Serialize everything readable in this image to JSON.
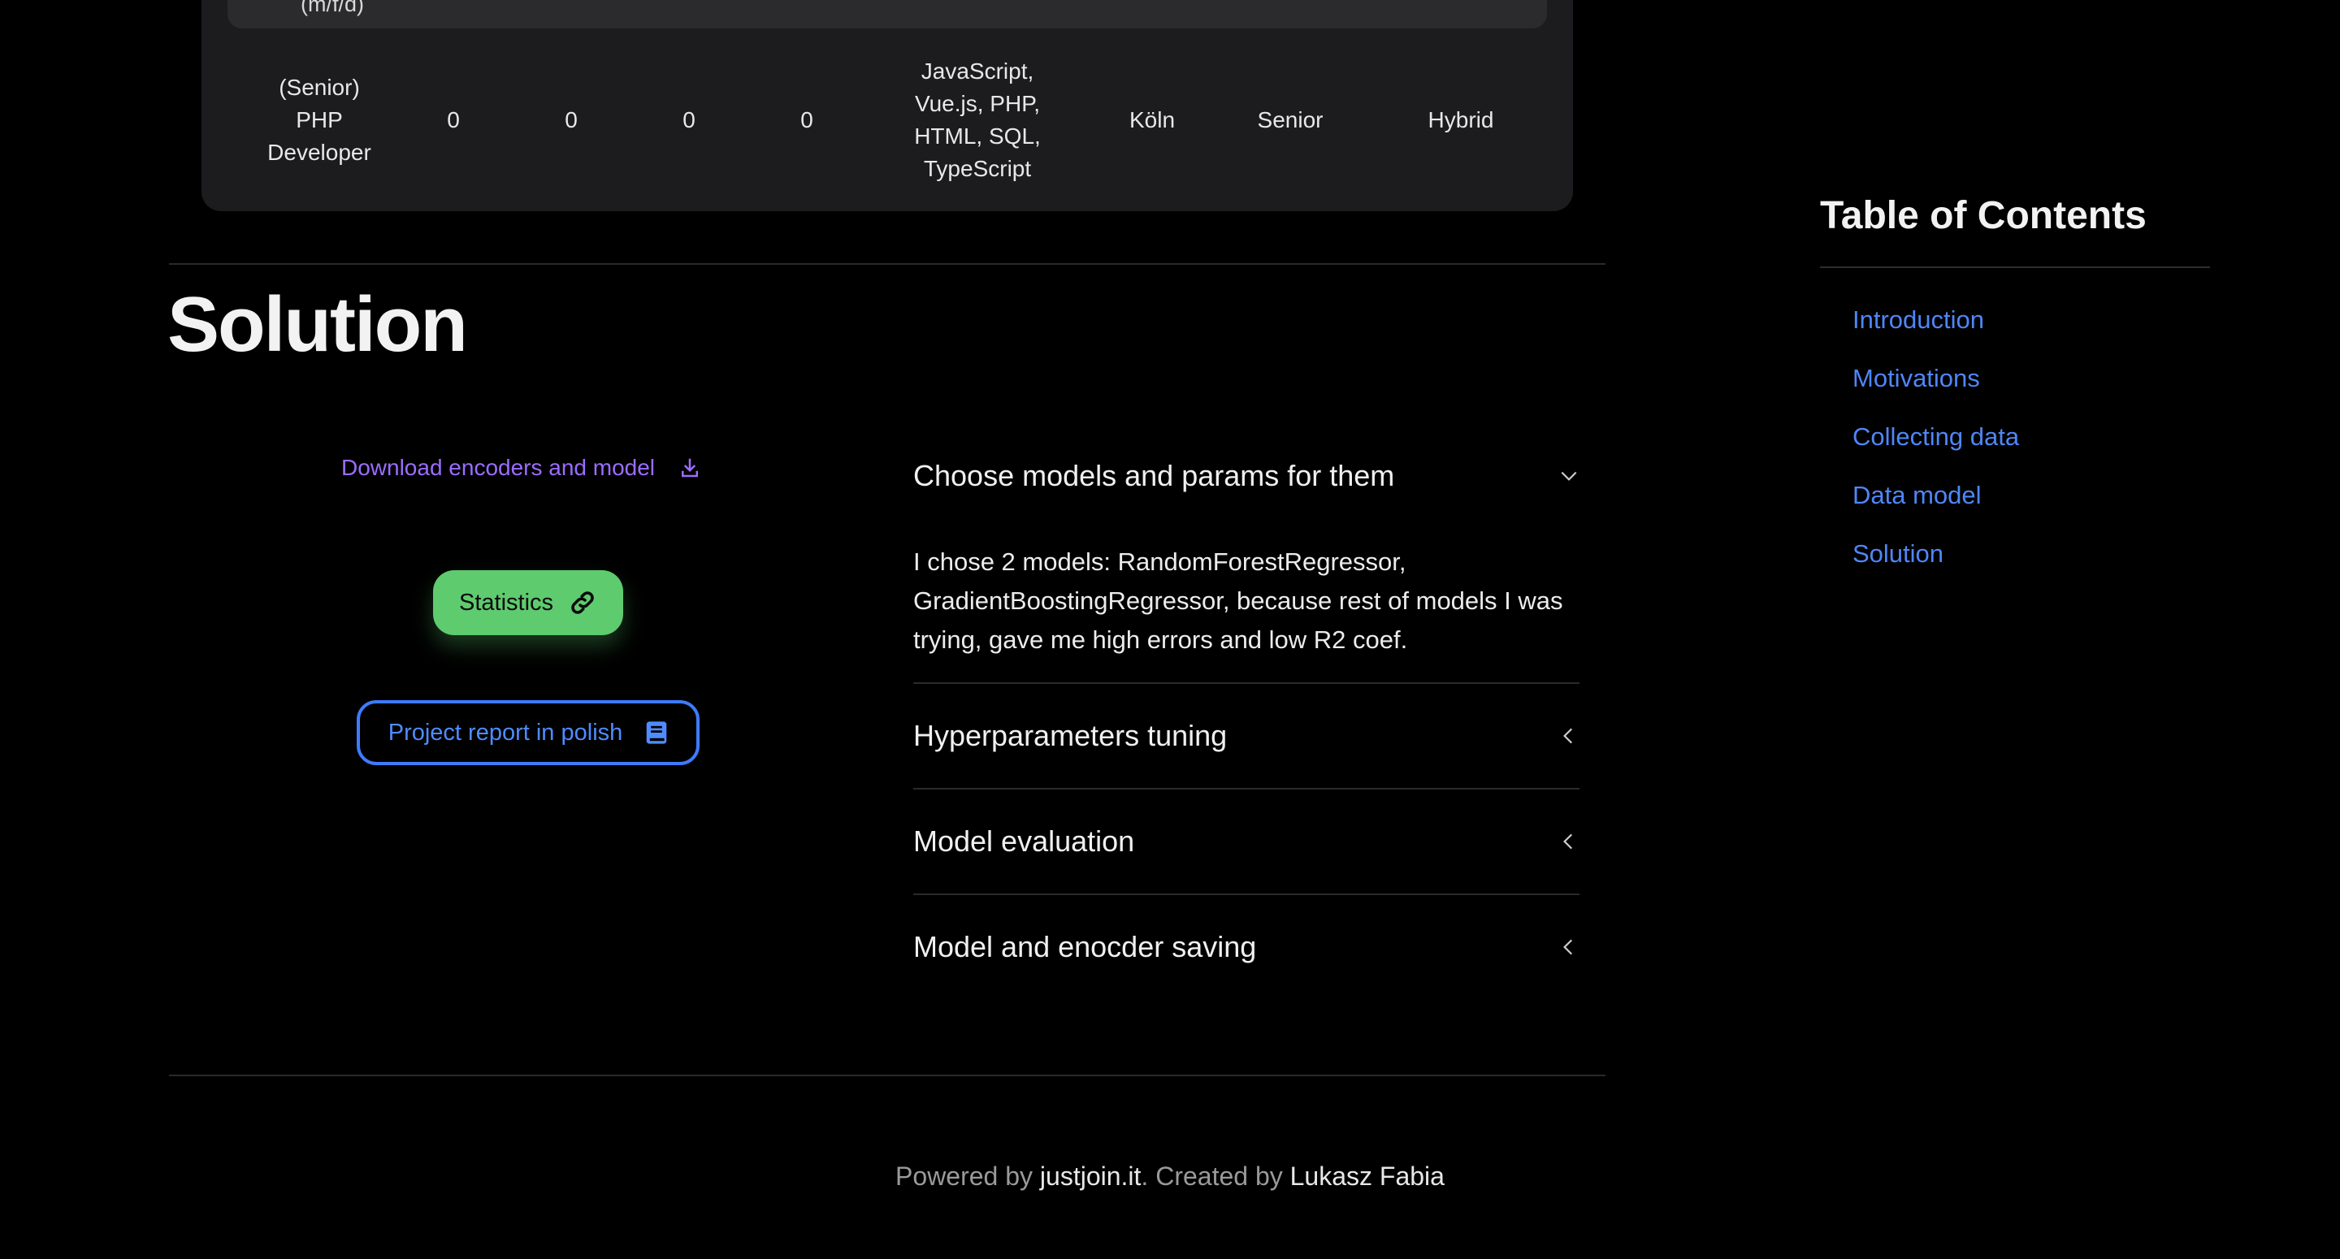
{
  "table": {
    "header_clip": "(m/f/d)",
    "row": [
      "(Senior)\nPHP\nDeveloper",
      "0",
      "0",
      "0",
      "0",
      "JavaScript,\nVue.js, PHP,\nHTML, SQL,\nTypeScript",
      "Köln",
      "Senior",
      "Hybrid"
    ]
  },
  "solution": {
    "title": "Solution",
    "download_label": "Download encoders and model",
    "statistics_label": "Statistics",
    "report_label": "Project report in polish"
  },
  "accordion": [
    {
      "title": "Choose models and params for them",
      "expanded": true,
      "body": "I chose 2 models: RandomForestRegressor, GradientBoostingRegressor, because rest of models I was trying, gave me high errors and low R2 coef."
    },
    {
      "title": "Hyperparameters tuning",
      "expanded": false
    },
    {
      "title": "Model evaluation",
      "expanded": false
    },
    {
      "title": "Model and enocder saving",
      "expanded": false
    }
  ],
  "toc": {
    "title": "Table of Contents",
    "items": [
      "Introduction",
      "Motivations",
      "Collecting data",
      "Data model",
      "Solution"
    ]
  },
  "footer": {
    "powered_prefix": "Powered by ",
    "powered_link": "justjoin.it",
    "created_prefix": ". Created by ",
    "author": "Lukasz Fabia"
  },
  "colors": {
    "background": "#000000",
    "card": "#1c1c1e",
    "download_purple": "#9b6dff",
    "statistics_green": "#5ecb6e",
    "report_blue": "#3d7bff",
    "toc_link_blue": "#4f86f7"
  },
  "icons": {
    "download": "download-icon",
    "statistics": "link-icon",
    "report": "book-icon",
    "expanded": "chevron-down-icon",
    "collapsed": "chevron-left-icon"
  }
}
